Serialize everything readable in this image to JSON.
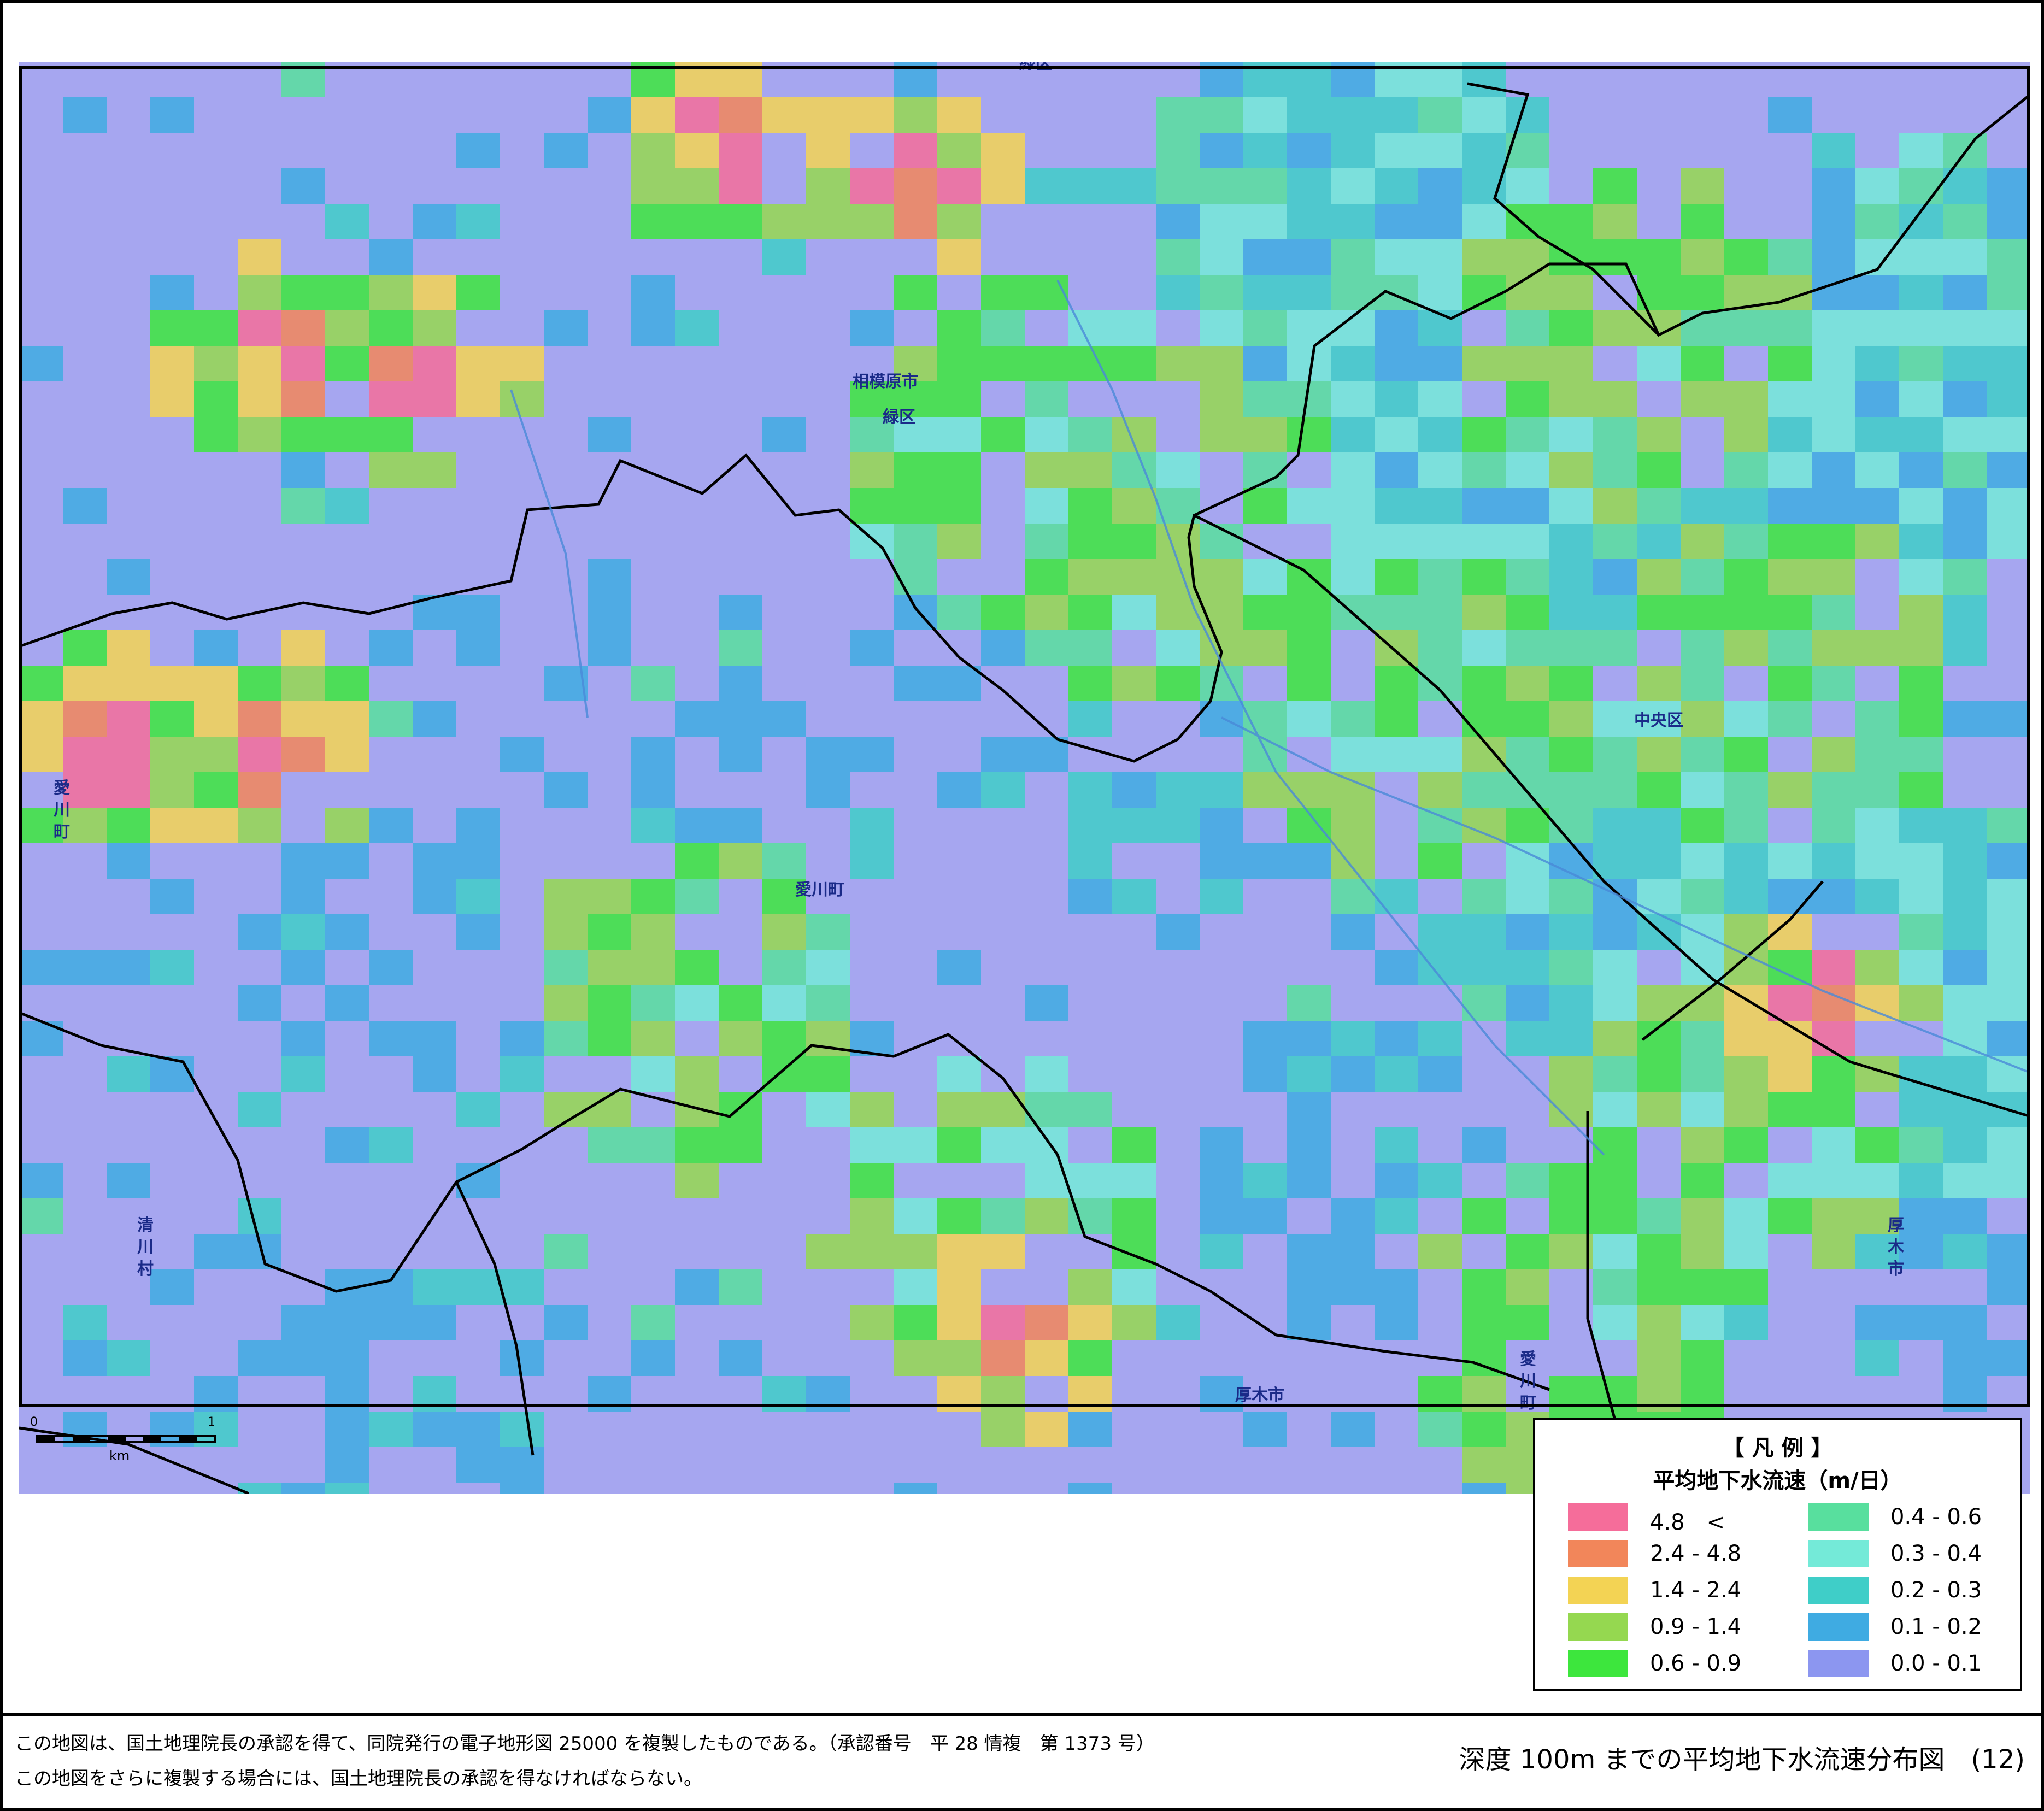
{
  "map": {
    "labels": {
      "top_district": "緑区",
      "sagamihara_city": "相模原市",
      "midori_ward": "緑区",
      "chuo_ward": "中央区",
      "aikawa_town": "愛川町",
      "aikawa_left": "愛川町",
      "kiyokawa_village": "清川村",
      "atsugi_city_right": "厚木市",
      "atsugi_city_bottom": "厚木市",
      "aikawa_bottom": "愛川町"
    },
    "scale": {
      "start": "0",
      "end": "1",
      "unit": "km"
    }
  },
  "legend": {
    "title": "【 凡 例 】",
    "subtitle": "平均地下水流速（m/日）",
    "items": [
      {
        "label": "4.8　<",
        "color": "#f56d9a"
      },
      {
        "label": "2.4 - 4.8",
        "color": "#f2865a"
      },
      {
        "label": "1.4 - 2.4",
        "color": "#f3d354"
      },
      {
        "label": "0.9 - 1.4",
        "color": "#95d850"
      },
      {
        "label": "0.6 - 0.9",
        "color": "#3de63d"
      },
      {
        "label": "0.4 - 0.6",
        "color": "#58df9e"
      },
      {
        "label": "0.3 - 0.4",
        "color": "#74ead8"
      },
      {
        "label": "0.2 - 0.3",
        "color": "#3fcec8"
      },
      {
        "label": "0.1 - 0.2",
        "color": "#3fabe2"
      },
      {
        "label": "0.0 - 0.1",
        "color": "#8c96f0"
      }
    ]
  },
  "footer": {
    "note1": "この地図は、国土地理院長の承認を得て、同院発行の電子地形図 25000 を複製したものである。（承認番号　平 28 情複　第 1373 号）",
    "note2": "この地図をさらに複製する場合には、国土地理院長の承認を得なければならない。",
    "caption": "深度 100m までの平均地下水流速分布図　(12)"
  }
}
